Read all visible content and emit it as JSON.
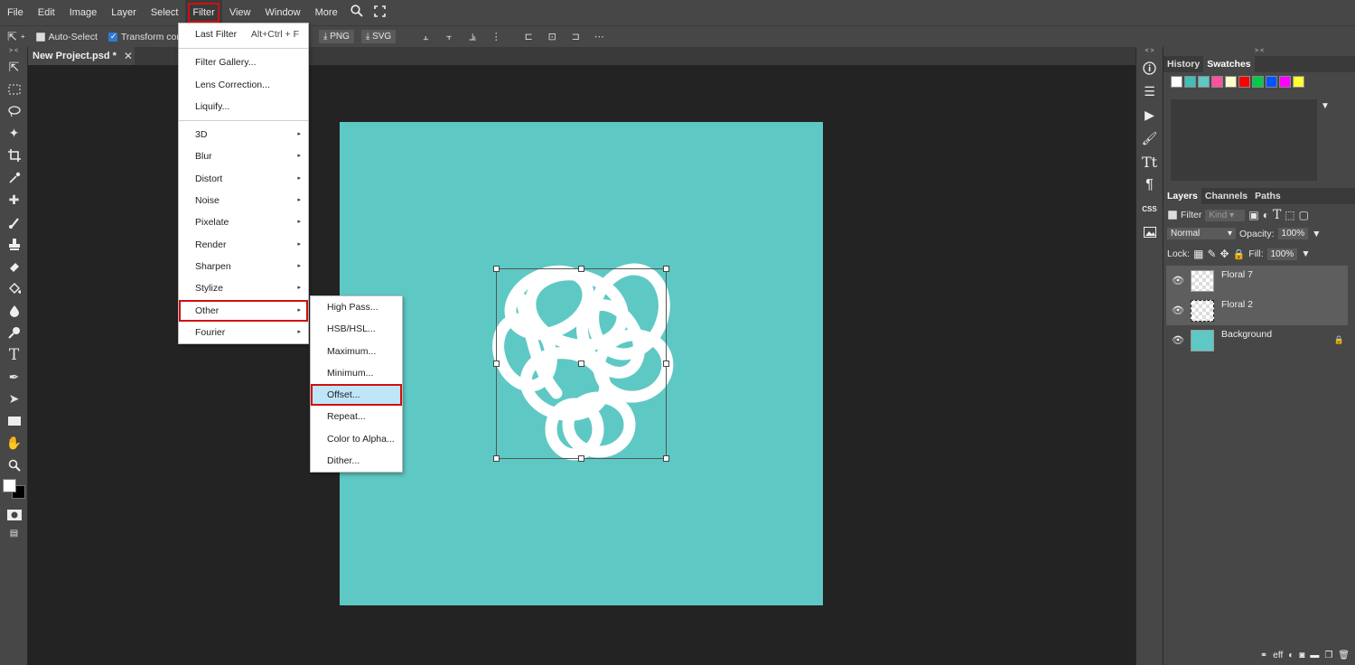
{
  "menubar": {
    "items": [
      "File",
      "Edit",
      "Image",
      "Layer",
      "Select",
      "Filter",
      "View",
      "Window",
      "More"
    ],
    "active": "Filter",
    "search_icon": "search-icon",
    "fullscreen_icon": "fullscreen-icon"
  },
  "options": {
    "auto_select": "Auto-Select",
    "transform_controls": "Transform controls",
    "export_png": "PNG",
    "export_svg": "SVG"
  },
  "document": {
    "tab_title": "New Project.psd *",
    "canvas_color": "#5ec8c4"
  },
  "filter_menu": {
    "last_filter": "Last Filter",
    "last_filter_shortcut": "Alt+Ctrl + F",
    "group1": [
      "Filter Gallery...",
      "Lens Correction...",
      "Liquify..."
    ],
    "submenus": [
      "3D",
      "Blur",
      "Distort",
      "Noise",
      "Pixelate",
      "Render",
      "Sharpen",
      "Stylize",
      "Other",
      "Fourier"
    ],
    "highlighted": "Other"
  },
  "other_submenu": {
    "items": [
      "High Pass...",
      "HSB/HSL...",
      "Maximum...",
      "Minimum...",
      "Offset...",
      "Repeat...",
      "Color to Alpha...",
      "Dither..."
    ],
    "selected": "Offset..."
  },
  "panels": {
    "top_tabs": [
      "History",
      "Swatches"
    ],
    "swatches": [
      "#ffffff",
      "#3fbfb8",
      "#5ec8c4",
      "#ff4fa0",
      "#ffffcc",
      "#ff0000",
      "#00cc44",
      "#0055ff",
      "#ff00ff",
      "#ffff33"
    ],
    "layer_tabs": [
      "Layers",
      "Channels",
      "Paths"
    ],
    "filter_label": "Filter",
    "kind_label": "Kind",
    "blend_mode": "Normal",
    "opacity_label": "Opacity:",
    "opacity_value": "100%",
    "lock_label": "Lock:",
    "fill_label": "Fill:",
    "fill_value": "100%",
    "layers": [
      {
        "name": "Floral 7",
        "selected": true
      },
      {
        "name": "Floral 2",
        "selected": true
      },
      {
        "name": "Background",
        "selected": false
      }
    ],
    "bottom_eff": "eff"
  }
}
